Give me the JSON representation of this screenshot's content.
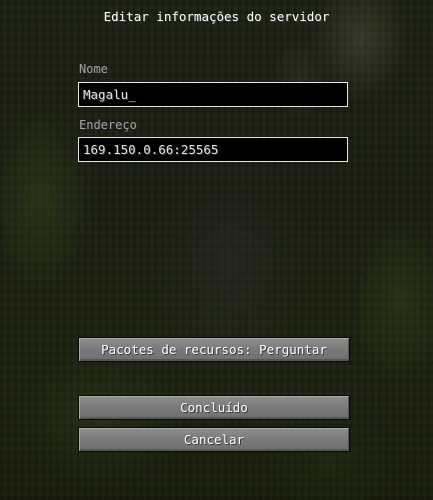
{
  "screen": {
    "title": "Editar informações do servidor"
  },
  "form": {
    "name_label": "Nome",
    "name_value": "Magalu_",
    "address_label": "Endereço",
    "address_value": "169.150.0.66:25565"
  },
  "buttons": {
    "resource_packs": "Pacotes de recursos: Perguntar",
    "done": "Concluído",
    "cancel": "Cancelar"
  },
  "colors": {
    "label_text": "#a0a0a0",
    "title_text": "#ffffff",
    "field_background": "#000000",
    "field_border": "#e6e6e6",
    "button_face": "#7a7a7a"
  }
}
